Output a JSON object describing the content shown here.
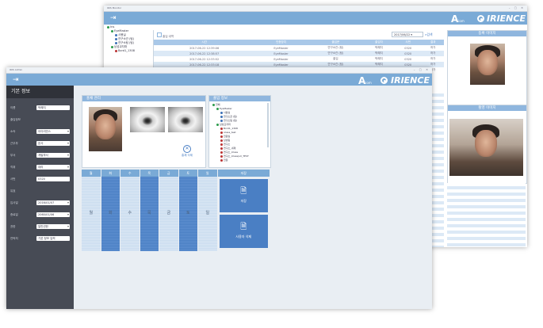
{
  "brand": {
    "logo_letter": "A",
    "logo_sub": "iom",
    "company": "IRIENCE"
  },
  "back_window": {
    "title": "IRIS Monitor",
    "tree": [
      {
        "label": "Iris",
        "dot": "green",
        "indent": 0
      },
      {
        "label": "EyeMaster",
        "dot": "green",
        "indent": 1
      },
      {
        "label": "사용실",
        "dot": "blue",
        "indent": 2
      },
      {
        "label": "연구소관 (팀)",
        "dot": "blue",
        "indent": 2
      },
      {
        "label": "연구소팀 (팀)",
        "dot": "blue",
        "indent": 2
      },
      {
        "label": "남성교자파",
        "dot": "green",
        "indent": 1
      },
      {
        "label": "Bxrd1_1308",
        "dot": "red",
        "indent": 2
      }
    ],
    "search_label": "출입 내역",
    "date_value": "2017/06/22",
    "search_button": "검색",
    "table": {
      "headers": [
        "시간",
        "인증장치",
        "출입문",
        "출입자",
        "사번",
        "결과"
      ],
      "rows": [
        [
          "2017-06-22 12:39:06",
          "EyeMaster",
          "연구소관 (팀)",
          "박혜지",
          "0320",
          "허가"
        ],
        [
          "2017-06-22 12:38:57",
          "EyeMaster",
          "연구소관 (팀)",
          "박혜지",
          "0320",
          "허가"
        ],
        [
          "2017-06-22 12:33:52",
          "EyeMaster",
          "출입",
          "박혜지",
          "0320",
          "허가"
        ],
        [
          "2017-06-22 12:33:18",
          "EyeMaster",
          "연구소관 (팀)",
          "박혜지",
          "0320",
          "허가"
        ],
        [
          "2017-06-22 12:31:08",
          "EyeMaster",
          "출입",
          "박혜지",
          "0320",
          "허가"
        ]
      ]
    },
    "registered_image_label": "등록 이미지",
    "capture_image_label": "촬영 이미지"
  },
  "front_window": {
    "title": "IRIS Admin",
    "sidebar": {
      "header": "기본 정보",
      "fields": [
        {
          "label": "이름",
          "value": "박혜지",
          "select": false
        },
        {
          "label": "출입정보",
          "value": "",
          "select": false
        },
        {
          "label": "소속",
          "value": "아이리언스",
          "select": true
        },
        {
          "label": "근무부",
          "value": "본사",
          "select": true
        },
        {
          "label": "부서",
          "value": "개발부서",
          "select": true
        },
        {
          "label": "직위",
          "value": "대리",
          "select": true
        },
        {
          "label": "사번",
          "value": "0320",
          "select": false
        },
        {
          "label": "유효",
          "value": "",
          "select": false
        },
        {
          "label": "입사일",
          "value": "2016/01/07",
          "select": true
        },
        {
          "label": "종료일",
          "value": "2060/01/06",
          "select": true
        },
        {
          "label": "권한",
          "value": "일반권한",
          "select": true
        },
        {
          "label": "연락처",
          "value": "기본 정보 입력",
          "select": false
        }
      ]
    },
    "bio_panel": {
      "title": "홍채 관리",
      "delete_label": "홍채 삭제"
    },
    "access_panel": {
      "title": "출입 정보",
      "tree": [
        {
          "label": "전체",
          "dot": "green",
          "indent": 0
        },
        {
          "label": "EyeMaster",
          "dot": "green",
          "indent": 1
        },
        {
          "label": "사용실",
          "dot": "blue",
          "indent": 2
        },
        {
          "label": "연구소관 (팀)",
          "dot": "blue",
          "indent": 2
        },
        {
          "label": "연구소팀 (팀)",
          "dot": "blue",
          "indent": 2
        },
        {
          "label": "남성교자파",
          "dot": "green",
          "indent": 1
        },
        {
          "label": "Bxrd1_1308",
          "dot": "red",
          "indent": 2
        },
        {
          "label": "iclass_test",
          "dot": "red",
          "indent": 2
        },
        {
          "label": "전원실",
          "dot": "red",
          "indent": 2
        },
        {
          "label": "남성팀",
          "dot": "red",
          "indent": 2
        },
        {
          "label": "연구소",
          "dot": "red",
          "indent": 2
        },
        {
          "label": "연구소_내재",
          "dot": "red",
          "indent": 2
        },
        {
          "label": "연구소_Iclass",
          "dot": "red",
          "indent": 2
        },
        {
          "label": "연구소_Iclass(ull_TEST",
          "dot": "red",
          "indent": 2
        },
        {
          "label": "전문",
          "dot": "red",
          "indent": 2
        }
      ]
    },
    "schedule": {
      "days": [
        "월",
        "화",
        "수",
        "목",
        "금",
        "토",
        "일"
      ],
      "save_header": "저장",
      "save_label": "저장",
      "delete_label": "사용자 삭제"
    }
  }
}
